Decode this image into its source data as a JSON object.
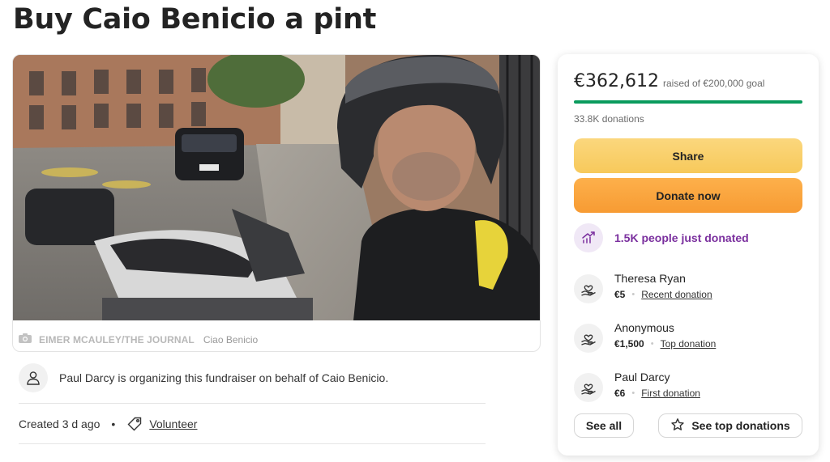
{
  "page": {
    "title": "Buy Caio Benicio a pint"
  },
  "photo": {
    "credit": "EIMER MCAULEY/THE JOURNAL",
    "caption": "Ciao Benicio"
  },
  "organizer": {
    "text": "Paul Darcy is organizing this fundraiser on behalf of Caio Benicio."
  },
  "meta": {
    "created": "Created 3 d ago",
    "separator": "•",
    "volunteer_label": "Volunteer"
  },
  "stats": {
    "raised": "€362,612",
    "goal_text": "raised of €200,000 goal",
    "progress_fraction": 1.0,
    "donations_count": "33.8K donations"
  },
  "buttons": {
    "share": "Share",
    "donate": "Donate now",
    "see_all": "See all",
    "see_top": "See top donations"
  },
  "trending": {
    "text": "1.5K people just donated"
  },
  "donations": [
    {
      "name": "Theresa Ryan",
      "amount": "€5",
      "type": "Recent donation"
    },
    {
      "name": "Anonymous",
      "amount": "€1,500",
      "type": "Top donation"
    },
    {
      "name": "Paul Darcy",
      "amount": "€6",
      "type": "First donation"
    }
  ],
  "colors": {
    "progress": "#0a9b5d",
    "share_button": "#f7c95b",
    "donate_button": "#f79b33",
    "trending_text": "#7a2f9e"
  },
  "icons": {
    "camera": "camera-icon",
    "organizer": "person-icon",
    "volunteer": "tag-icon",
    "trending": "trending-up-icon",
    "donor": "heart-hand-icon",
    "top_donations": "star-icon"
  }
}
